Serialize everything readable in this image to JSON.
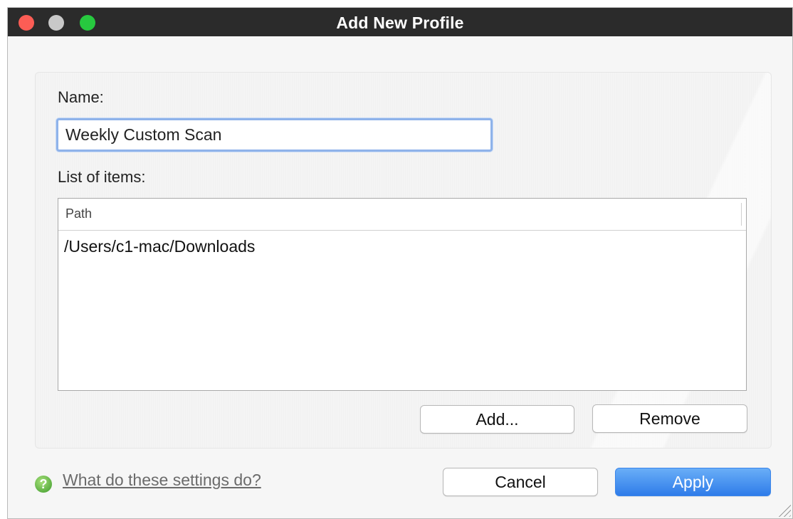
{
  "window": {
    "title": "Add New Profile"
  },
  "form": {
    "name_label": "Name:",
    "name_value": "Weekly Custom Scan",
    "list_label": "List of items:"
  },
  "table": {
    "columns": [
      "Path"
    ],
    "rows": [
      {
        "path": "/Users/c1-mac/Downloads"
      }
    ]
  },
  "buttons": {
    "add": "Add...",
    "remove": "Remove",
    "cancel": "Cancel",
    "apply": "Apply"
  },
  "help": {
    "icon": "question-mark-icon",
    "link_text": "What do these settings do?"
  },
  "colors": {
    "titlebar": "#2b2b2b",
    "close": "#fc5d55",
    "minimize": "#c8c8c8",
    "zoom": "#27c93f",
    "apply_button": "#2f7ce9"
  }
}
